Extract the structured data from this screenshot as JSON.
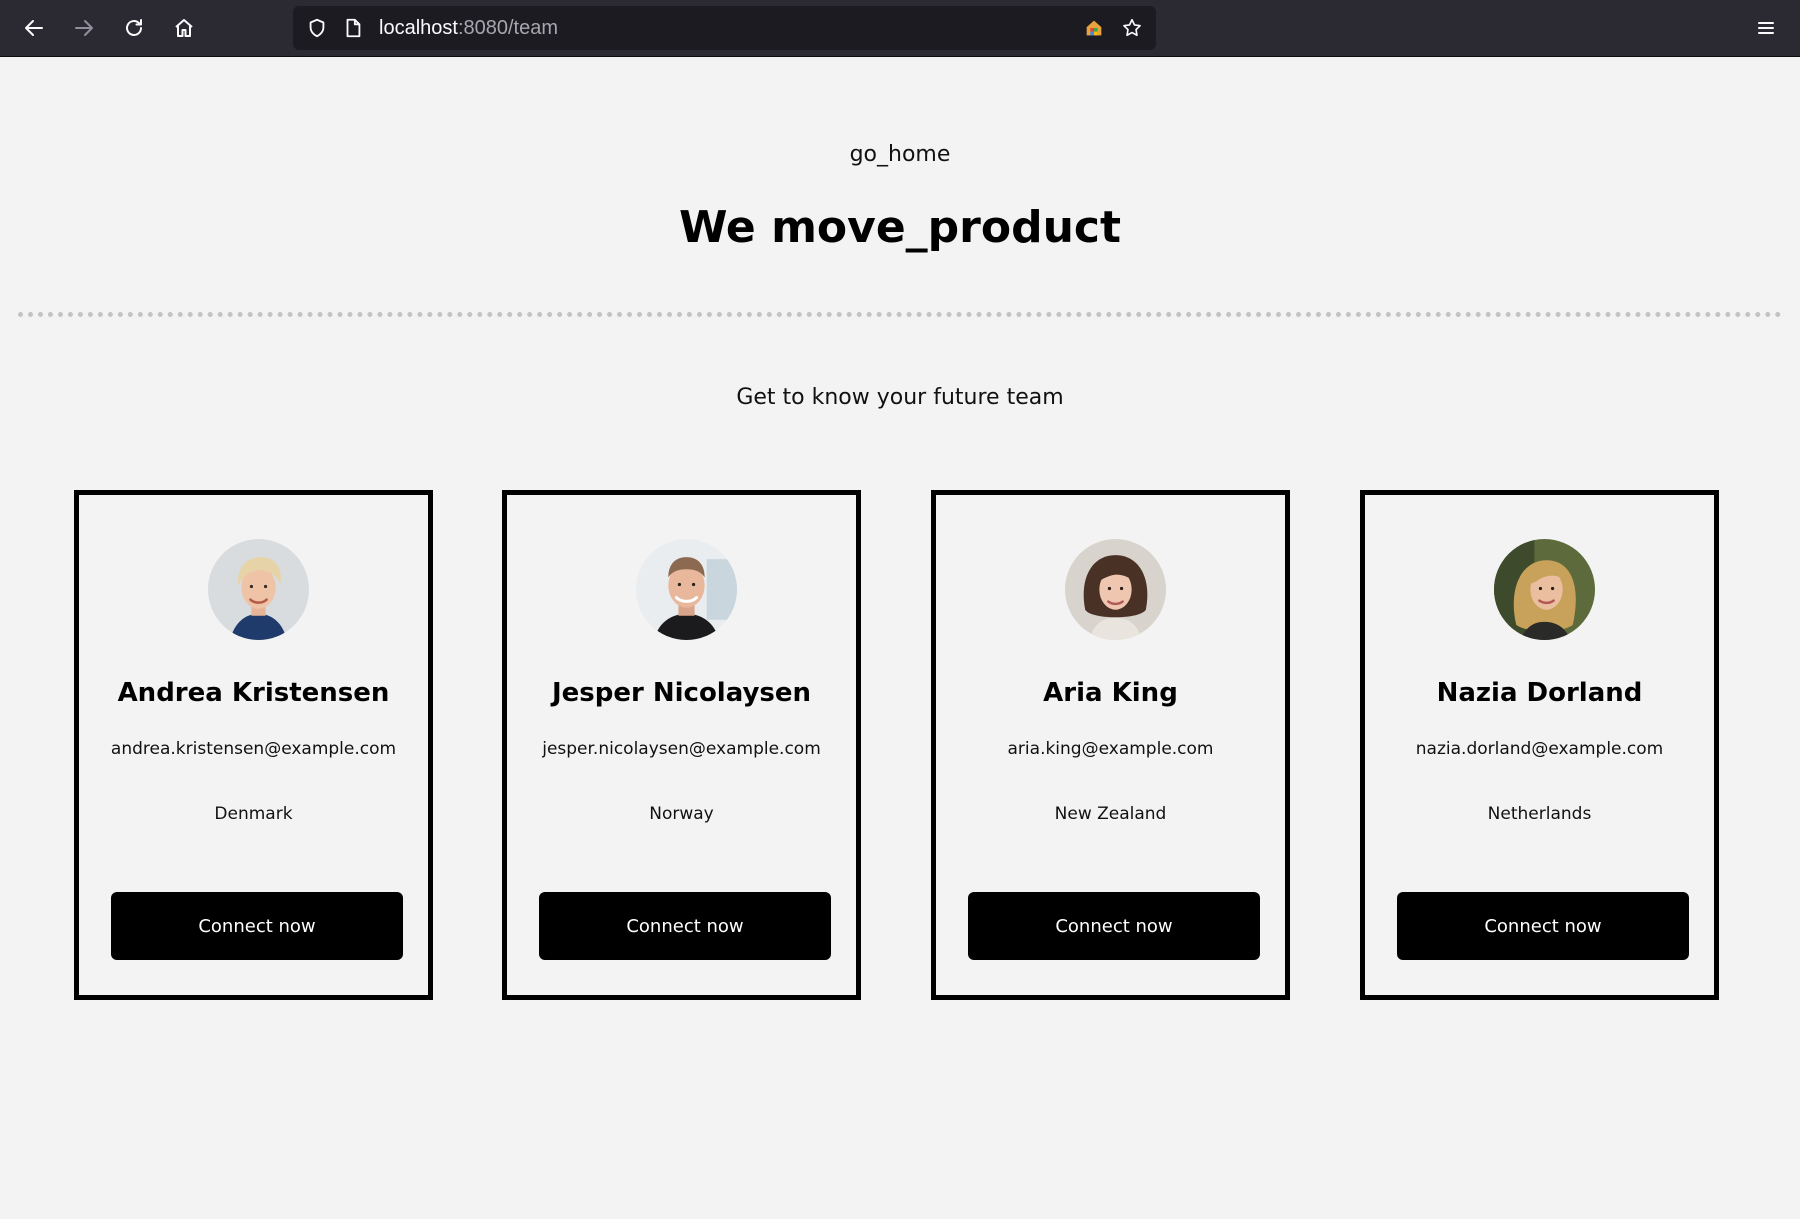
{
  "browser": {
    "url_host": "localhost",
    "url_path": ":8080/team",
    "icons": [
      "back-arrow-icon",
      "forward-arrow-icon",
      "reload-icon",
      "home-icon",
      "shield-icon",
      "page-icon",
      "extension-icon",
      "star-icon",
      "hamburger-menu-icon"
    ]
  },
  "page": {
    "go_home": "go_home",
    "headline": "We move_product",
    "subtitle": "Get to know your future team"
  },
  "team": [
    {
      "name": "Andrea Kristensen",
      "email": "andrea.kristensen@example.com",
      "country": "Denmark",
      "button": "Connect now"
    },
    {
      "name": "Jesper Nicolaysen",
      "email": "jesper.nicolaysen@example.com",
      "country": "Norway",
      "button": "Connect now"
    },
    {
      "name": "Aria King",
      "email": "aria.king@example.com",
      "country": "New Zealand",
      "button": "Connect now"
    },
    {
      "name": "Nazia Dorland",
      "email": "nazia.dorland@example.com",
      "country": "Netherlands",
      "button": "Connect now"
    }
  ],
  "colors": {
    "toolbar_bg": "#2b2a33",
    "urlbar_bg": "#1c1b22",
    "page_bg": "#f3f3f3",
    "button_bg": "#000000",
    "button_text": "#ffffff",
    "divider": "#c3c3c3"
  }
}
